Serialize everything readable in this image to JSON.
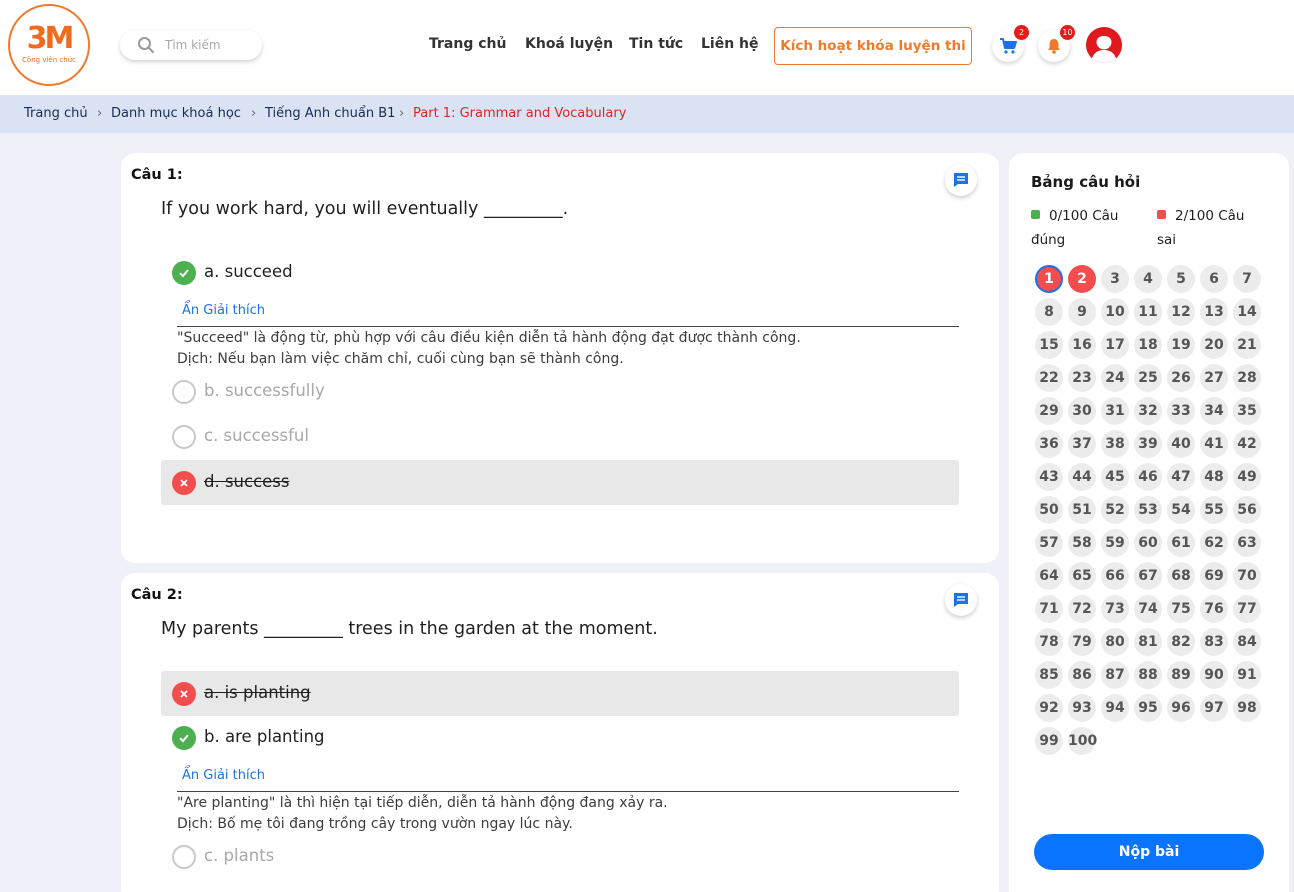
{
  "header": {
    "logo_text": "3M",
    "logo_subtitle": "Công viên chức",
    "search_placeholder": "Tìm kiếm",
    "nav": [
      "Trang chủ",
      "Khoá luyện",
      "Tin tức",
      "Liên hệ"
    ],
    "activate_label": "Kích hoạt khóa luyện thi",
    "cart_count": "2",
    "notification_count": "10",
    "icons": [
      "search-icon",
      "cart-icon",
      "bell-icon",
      "user-avatar"
    ]
  },
  "breadcrumb": [
    "Trang chủ",
    "Danh mục khoá học",
    "Tiếng Anh chuẩn B1",
    "Part 1: Grammar and Vocabulary"
  ],
  "questions": [
    {
      "label": "Câu 1:",
      "text": "If you work hard, you will eventually _________.",
      "options": [
        "a. succeed",
        "b. successfully",
        "c. successful",
        "d. success"
      ],
      "explain_toggle": "Ẩn Giải thích",
      "explanation": [
        "\"Succeed\" là động từ, phù hợp với câu điều kiện diễn tả hành động đạt được thành công.",
        "Dịch: Nếu bạn làm việc chăm chỉ, cuối cùng bạn sẽ thành công."
      ]
    },
    {
      "label": "Câu 2:",
      "text": "My parents _________ trees in the garden at the moment.",
      "options": [
        "a. is planting",
        "b. are planting",
        "c. plants"
      ],
      "explain_toggle": "Ẩn Giải thích",
      "explanation": [
        "\"Are planting\" là thì hiện tại tiếp diễn, diễn tả hành động đang xảy ra.",
        "Dịch: Bố mẹ tôi đang trồng cây trong vườn ngay lúc này."
      ]
    }
  ],
  "panel": {
    "title": "Bảng câu hỏi",
    "correct_line1": "0/100 Câu",
    "correct_line2": "đúng",
    "wrong_line1": "2/100 Câu",
    "wrong_line2": "sai",
    "total": 100,
    "wrong_numbers": [
      1,
      2
    ],
    "current": 1,
    "submit_label": "Nộp bài"
  },
  "colors": {
    "brand": "#f07a2c",
    "correct": "#4caf50",
    "wrong": "#f44d4d",
    "primary": "#0b74ff",
    "breadcrumb_bg": "#d9e3f3"
  }
}
